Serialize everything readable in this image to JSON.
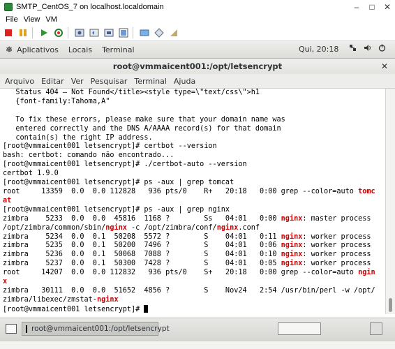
{
  "window": {
    "title": "SMTP_CentOS_7 on localhost.localdomain"
  },
  "menubar": {
    "items": [
      "File",
      "View",
      "VM"
    ]
  },
  "gnome": {
    "applications": "Aplicativos",
    "places": "Locais",
    "terminal": "Terminal",
    "clock": "Qui, 20:18"
  },
  "terminal": {
    "title": "root@vmmaicent001:/opt/letsencrypt",
    "menu": [
      "Arquivo",
      "Editar",
      "Ver",
      "Pesquisar",
      "Terminal",
      "Ajuda"
    ],
    "lines": [
      [
        [
          "   Status 404 – Not Found</title><style type=\\\"text/css\\\">h1",
          ""
        ]
      ],
      [
        [
          "   {font-family:Tahoma,A\"",
          ""
        ]
      ],
      [
        [
          "",
          ""
        ]
      ],
      [
        [
          "   To fix these errors, please make sure that your domain name was",
          ""
        ]
      ],
      [
        [
          "   entered correctly and the DNS A/AAAA record(s) for that domain",
          ""
        ]
      ],
      [
        [
          "   contain(s) the right IP address.",
          ""
        ]
      ],
      [
        [
          "[root@vmmaicent001 letsencrypt]# certbot --version",
          ""
        ]
      ],
      [
        [
          "bash: certbot: comando não encontrado...",
          ""
        ]
      ],
      [
        [
          "[root@vmmaicent001 letsencrypt]# ./certbot-auto --version",
          ""
        ]
      ],
      [
        [
          "certbot 1.9.0",
          ""
        ]
      ],
      [
        [
          "[root@vmmaicent001 letsencrypt]# ps -aux | grep tomcat",
          ""
        ]
      ],
      [
        [
          "root     13359  0.0  0.0 112828   936 pts/0    R+   20:18   0:00 grep --color=auto ",
          ""
        ],
        [
          "tomc",
          "hl"
        ]
      ],
      [
        [
          "at",
          "hl"
        ]
      ],
      [
        [
          "[root@vmmaicent001 letsencrypt]# ps -aux | grep nginx",
          ""
        ]
      ],
      [
        [
          "zimbra    5233  0.0  0.0  45816  1168 ?        Ss   04:01   0:00 ",
          ""
        ],
        [
          "nginx",
          "hl"
        ],
        [
          ": master process",
          ""
        ]
      ],
      [
        [
          "/opt/zimbra/common/sbin/",
          ""
        ],
        [
          "nginx",
          "hl"
        ],
        [
          " -c /opt/zimbra/conf/",
          ""
        ],
        [
          "nginx",
          "hl"
        ],
        [
          ".conf",
          ""
        ]
      ],
      [
        [
          "zimbra    5234  0.0  0.1  50208  5572 ?        S    04:01   0:11 ",
          ""
        ],
        [
          "nginx",
          "hl"
        ],
        [
          ": worker process",
          ""
        ]
      ],
      [
        [
          "zimbra    5235  0.0  0.1  50200  7496 ?        S    04:01   0:06 ",
          ""
        ],
        [
          "nginx",
          "hl"
        ],
        [
          ": worker process",
          ""
        ]
      ],
      [
        [
          "zimbra    5236  0.0  0.1  50068  7088 ?        S    04:01   0:10 ",
          ""
        ],
        [
          "nginx",
          "hl"
        ],
        [
          ": worker process",
          ""
        ]
      ],
      [
        [
          "zimbra    5237  0.0  0.1  50300  7428 ?        S    04:01   0:05 ",
          ""
        ],
        [
          "nginx",
          "hl"
        ],
        [
          ": worker process",
          ""
        ]
      ],
      [
        [
          "root     14207  0.0  0.0 112832   936 pts/0    S+   20:18   0:00 grep --color=auto ",
          ""
        ],
        [
          "ngin",
          "hl"
        ]
      ],
      [
        [
          "x",
          "hl"
        ]
      ],
      [
        [
          "zimbra   30111  0.0  0.0  51652  4856 ?        S    Nov24   2:54 /usr/bin/perl -w /opt/",
          ""
        ]
      ],
      [
        [
          "zimbra/libexec/zmstat-",
          ""
        ],
        [
          "nginx",
          "hl"
        ]
      ],
      [
        [
          "[root@vmmaicent001 letsencrypt]# ",
          ""
        ]
      ]
    ]
  },
  "taskbar": {
    "task_label": "root@vmmaicent001:/opt/letsencrypt"
  },
  "colors": {
    "highlight": "#cc0000",
    "terminal_bg": "#ffffff",
    "terminal_fg": "#000000"
  }
}
